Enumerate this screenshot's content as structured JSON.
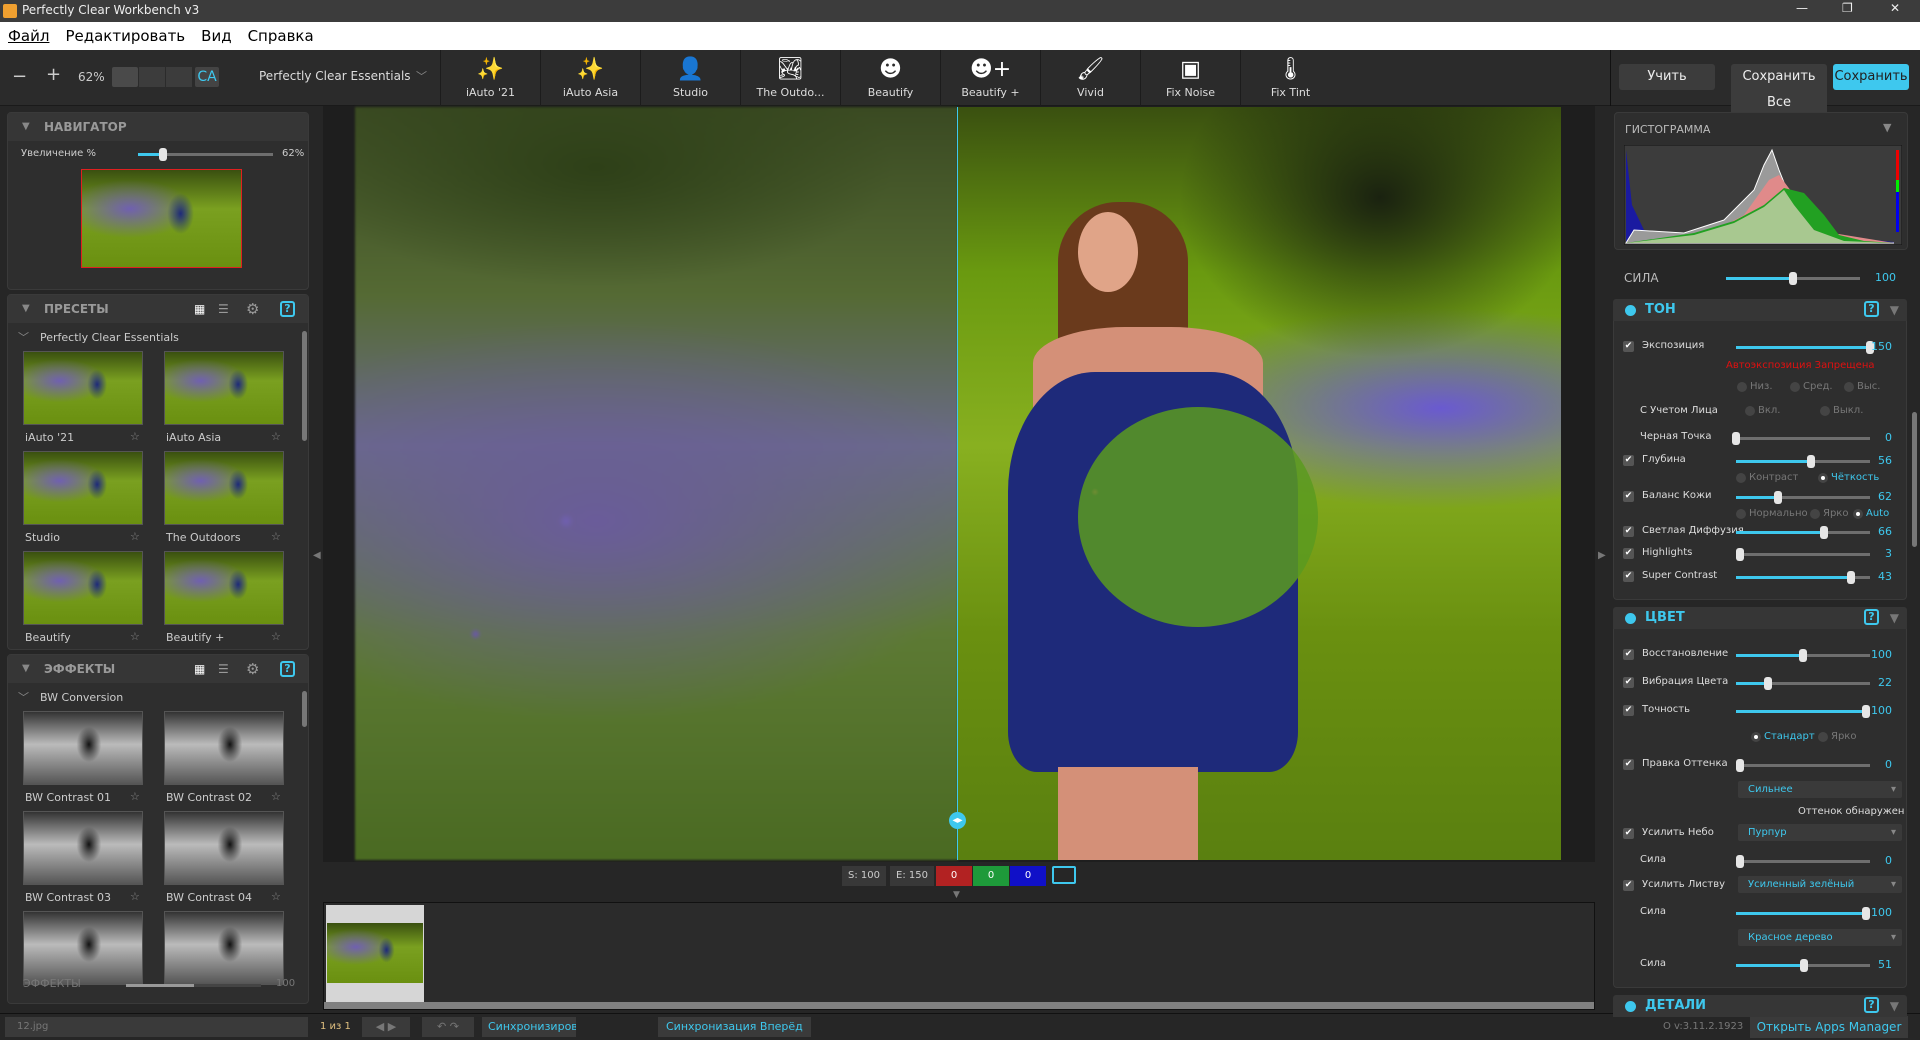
{
  "app": {
    "title": "Perfectly Clear Workbench v3"
  },
  "menu": [
    "Файл",
    "Редактировать",
    "Вид",
    "Справка"
  ],
  "toolbar": {
    "zoom": "62%",
    "ca_label": "CA",
    "preset_group": "Perfectly Clear Essentials",
    "presets": [
      {
        "label": "iAuto '21",
        "icon": "magic-wand"
      },
      {
        "label": "iAuto Asia",
        "icon": "magic-wand"
      },
      {
        "label": "Studio",
        "icon": "portrait"
      },
      {
        "label": "The Outdo...",
        "icon": "landscape"
      },
      {
        "label": "Beautify",
        "icon": "face"
      },
      {
        "label": "Beautify +",
        "icon": "face-plus"
      },
      {
        "label": "Vivid",
        "icon": "brush"
      },
      {
        "label": "Fix Noise",
        "icon": "noise"
      },
      {
        "label": "Fix Tint",
        "icon": "thermometer"
      }
    ],
    "learn": "Учить",
    "save_all": "Сохранить Все",
    "save": "Сохранить"
  },
  "navigator": {
    "title": "НАВИГАТОР",
    "zoom_label": "Увеличение %",
    "zoom_value": "62%",
    "zoom_percent": 62
  },
  "presets": {
    "title": "ПРЕСЕТЫ",
    "group": "Perfectly Clear Essentials",
    "items": [
      "iAuto '21",
      "iAuto Asia",
      "Studio",
      "The Outdoors",
      "Beautify",
      "Beautify +"
    ]
  },
  "effects": {
    "title": "ЭФФЕКТЫ",
    "group": "BW Conversion",
    "items": [
      "BW Contrast 01",
      "BW Contrast 02",
      "BW Contrast 03",
      "BW Contrast 04",
      "",
      ""
    ],
    "footer_label": "ЭФФЕКТЫ",
    "footer_value": "100"
  },
  "infobar": {
    "s": "S: 100",
    "e": "E: 150",
    "r": "0",
    "g": "0",
    "b": "0"
  },
  "bottom": {
    "file": "12.jpg",
    "page": "1 из 1",
    "sync_all": "Синхронизировать все",
    "sync_forward": "Синхронизация Вперёд",
    "version": "O v:3.11.2.1923",
    "apps_manager": "Открыть Apps Manager"
  },
  "histogram": {
    "title": "ГИСТОГРАММА",
    "strength_label": "СИЛА",
    "strength_value": "100"
  },
  "tone": {
    "title": "ТОН",
    "warning": "Автоэкспозиция Запрещена",
    "sliders": [
      {
        "label": "Экспозиция",
        "value": "150",
        "pct": 100,
        "check": true
      },
      {
        "label": "Черная Точка",
        "value": "0",
        "pct": 0,
        "check": false
      },
      {
        "label": "Глубина",
        "value": "56",
        "pct": 56,
        "check": true
      },
      {
        "label": "Баланс Кожи",
        "value": "62",
        "pct": 31,
        "check": true
      },
      {
        "label": "Светлая Диффузия",
        "value": "66",
        "pct": 66,
        "check": true
      },
      {
        "label": "Highlights",
        "value": "3",
        "pct": 3,
        "check": true
      },
      {
        "label": "Super Contrast",
        "value": "43",
        "pct": 86,
        "check": true
      }
    ],
    "exposure_levels": [
      "Низ.",
      "Сред.",
      "Выс."
    ],
    "face_label": "С Учетом Лица",
    "face_opts": [
      "Вкл.",
      "Выкл."
    ],
    "depth_opts": [
      "Контраст",
      "Чёткость"
    ],
    "skin_opts": [
      "Нормально",
      "Ярко",
      "Auto"
    ]
  },
  "color": {
    "title": "ЦВЕТ",
    "sliders": [
      {
        "label": "Восстановление",
        "value": "100",
        "pct": 50,
        "check": true
      },
      {
        "label": "Вибрация Цвета",
        "value": "22",
        "pct": 24,
        "check": true
      },
      {
        "label": "Точность",
        "value": "100",
        "pct": 97,
        "check": true
      },
      {
        "label": "Правка Оттенка",
        "value": "0",
        "pct": 3,
        "check": true
      },
      {
        "label": "Сила",
        "value": "0",
        "pct": 3,
        "check": false
      },
      {
        "label": "Сила",
        "value": "100",
        "pct": 97,
        "check": false
      },
      {
        "label": "Сила",
        "value": "51",
        "pct": 51,
        "check": false
      }
    ],
    "accuracy_opts": [
      "Стандарт",
      "Ярко"
    ],
    "tint_mode": "Сильнее",
    "tint_detected": "Оттенок обнаружен",
    "sky_label": "Усилить Небо",
    "sky_value": "Пурпур",
    "foliage_label": "Усилить Листву",
    "foliage_value": "Усиленный зелёный",
    "foliage2_value": "Красное дерево"
  },
  "details": {
    "title": "ДЕТАЛИ"
  }
}
